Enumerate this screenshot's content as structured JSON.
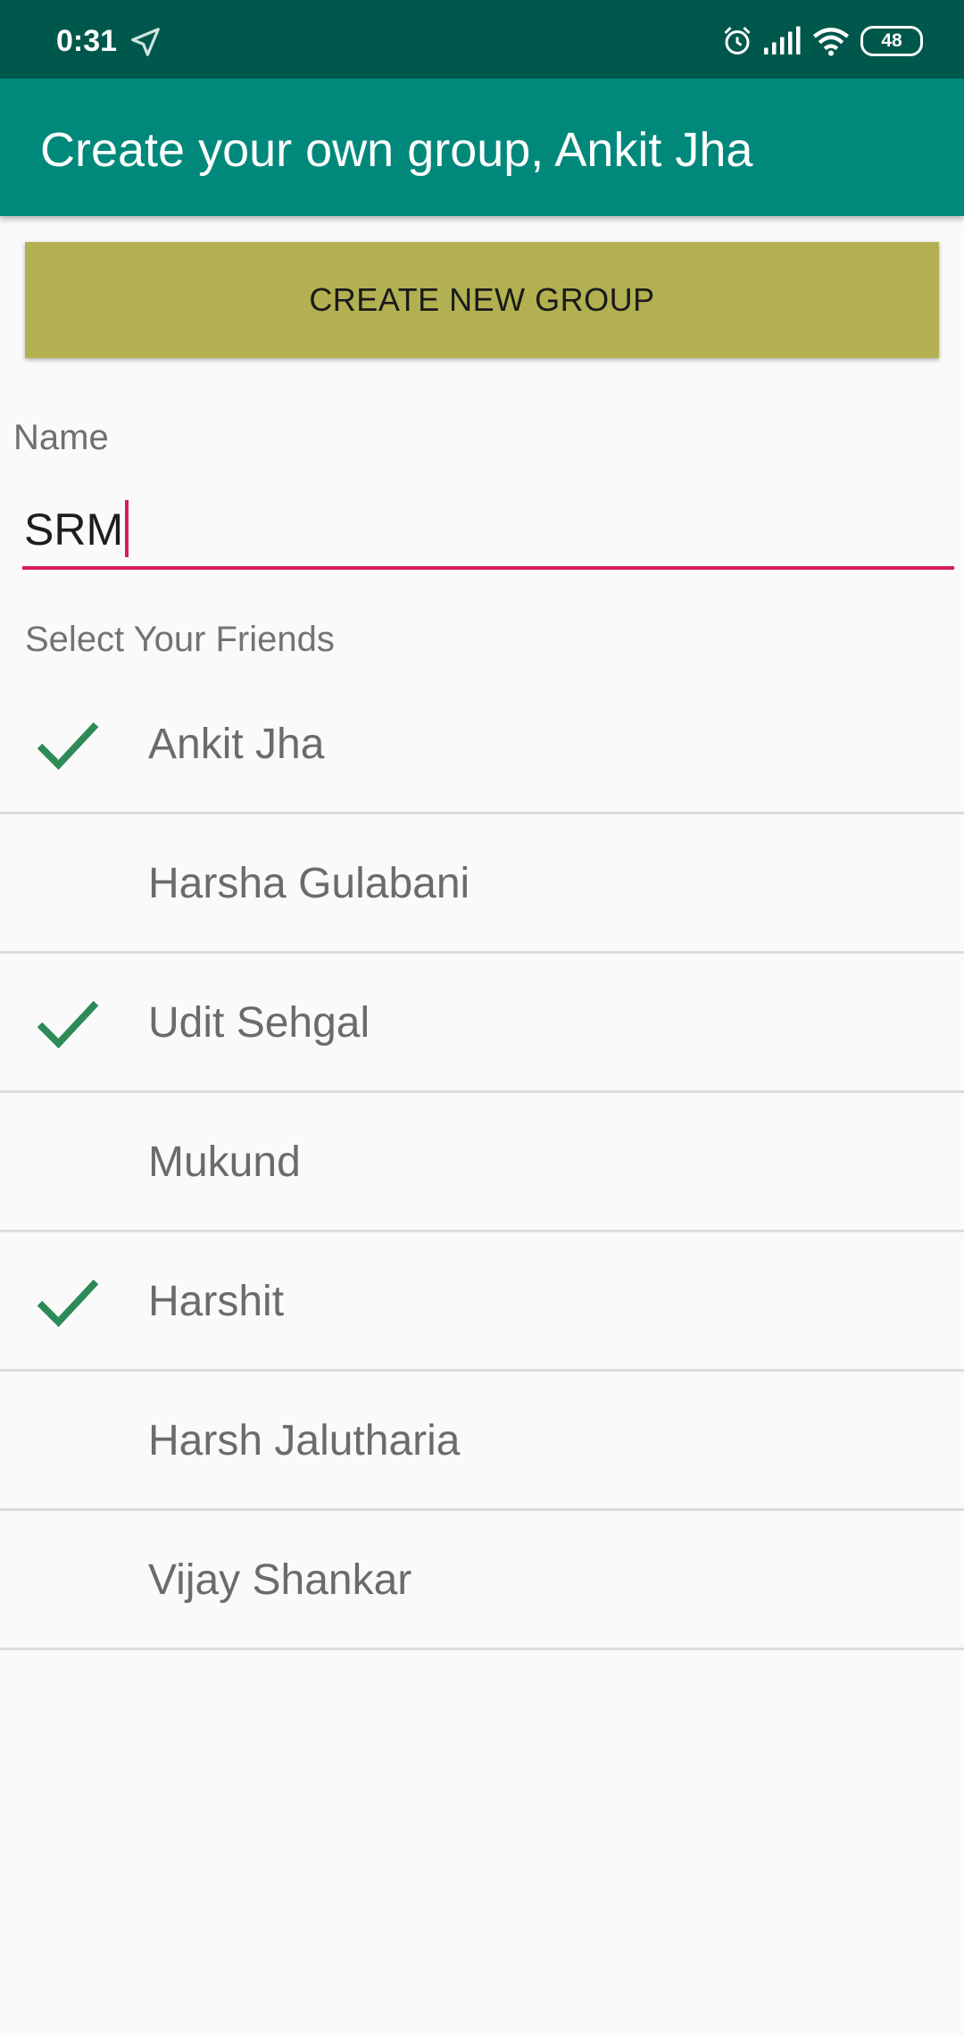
{
  "status_bar": {
    "time": "0:31",
    "battery": "48",
    "icons": [
      "navigation-icon",
      "alarm-icon",
      "signal-icon",
      "wifi-icon",
      "battery-icon"
    ]
  },
  "app_bar": {
    "title": "Create your own group, Ankit Jha"
  },
  "create_button": {
    "label": "CREATE NEW GROUP"
  },
  "name_field": {
    "label": "Name",
    "value": "SRM"
  },
  "friends": {
    "label": "Select Your Friends",
    "items": [
      {
        "name": "Ankit Jha",
        "selected": true
      },
      {
        "name": "Harsha Gulabani",
        "selected": false
      },
      {
        "name": "Udit Sehgal",
        "selected": true
      },
      {
        "name": "Mukund",
        "selected": false
      },
      {
        "name": "Harshit",
        "selected": true
      },
      {
        "name": "Harsh Jalutharia",
        "selected": false
      },
      {
        "name": "Vijay Shankar",
        "selected": false
      }
    ]
  },
  "colors": {
    "status_bar": "#00574b",
    "app_bar": "#00897b",
    "button": "#b2b050",
    "accent": "#d81b60",
    "check": "#2e8b57"
  }
}
